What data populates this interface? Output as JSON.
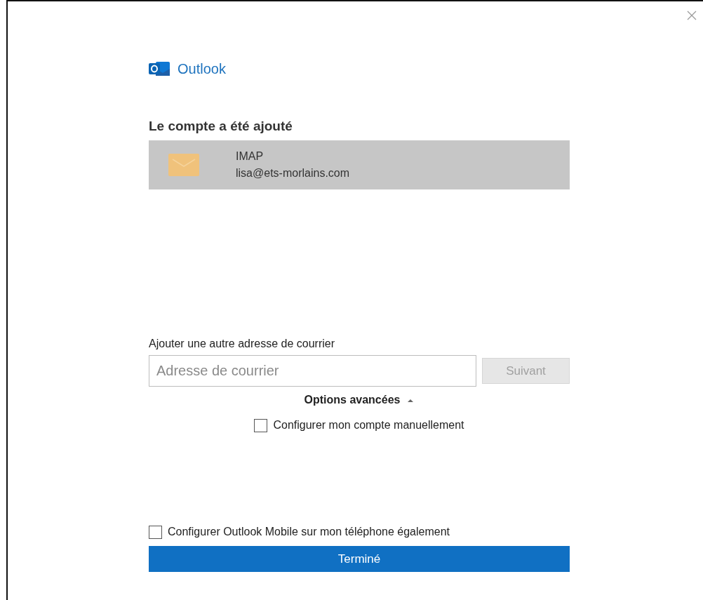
{
  "app": {
    "name": "Outlook"
  },
  "heading": "Le compte a été ajouté",
  "accounts": [
    {
      "type": "IMAP",
      "email": "lisa@ets-morlains.com",
      "selected": true
    }
  ],
  "add_account": {
    "label": "Ajouter une autre adresse de courrier",
    "placeholder": "Adresse de courrier",
    "next_button": {
      "label": "Suivant",
      "disabled": true
    }
  },
  "advanced_options": {
    "label": "Options avancées",
    "expanded": true,
    "options": [
      {
        "label": "Configurer mon compte manuellement",
        "checked": false
      }
    ]
  },
  "mobile_option": {
    "label": "Configurer Outlook Mobile sur mon téléphone également",
    "checked": false
  },
  "done_button": "Terminé"
}
